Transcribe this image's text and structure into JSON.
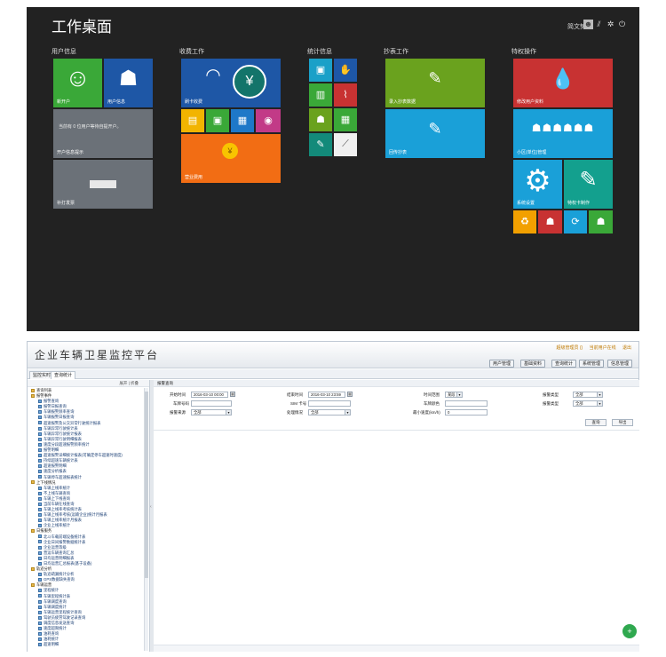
{
  "desktop": {
    "title": "工作桌面",
    "user_name": "简文势",
    "groups": {
      "user_info": "用户信息",
      "billing": "收费工作",
      "stats": "统计信息",
      "reading": "抄表工作",
      "privileged": "特权操作"
    },
    "tiles": {
      "new_user": "新开户",
      "user_info": "用户信息",
      "user_info_wide_text": "当前有 0 位用户等待自提开户。",
      "user_info_wide": "开户信息提示",
      "print": "补打发票",
      "card_charge": "刷卡收费",
      "business_expense": "营业费用",
      "batch_read": "录入抄表数据",
      "read_detail": "回传抄表",
      "modify_user": "修改用户资料",
      "community": "小区(单位)管理",
      "system_settings": "系统设置",
      "special_bill": "特权卡制作"
    }
  },
  "app": {
    "title": "企业车辆卫星监控平台",
    "top_links": [
      "超级管理员 ()",
      "当前用户在线",
      "退出"
    ],
    "menus": [
      "用户管理",
      "基础资料",
      "查询统计",
      "系统管理",
      "信息管理"
    ],
    "tabs": [
      "监控实时",
      "查询统计"
    ],
    "left_panel_head": [
      "展开",
      "折叠"
    ],
    "section_title": "报警查询",
    "tree": [
      {
        "t": "grp",
        "label": "查询列表"
      },
      {
        "t": "grp",
        "label": "报警事件"
      },
      {
        "t": "leaf",
        "label": "报警查询"
      },
      {
        "t": "leaf",
        "label": "报警日报查询"
      },
      {
        "t": "leaf",
        "label": "车辆报警频率查询"
      },
      {
        "t": "leaf",
        "label": "车辆报警日报查询"
      },
      {
        "t": "leaf",
        "label": "超速报警及公交异常行驶统计报表"
      },
      {
        "t": "leaf",
        "label": "车辆异常行驶统计表"
      },
      {
        "t": "leaf",
        "label": "车辆异常行驶统计报表"
      },
      {
        "t": "leaf",
        "label": "车辆异常行驶明细报表"
      },
      {
        "t": "leaf",
        "label": "速度分段超速报警频率统计"
      },
      {
        "t": "leaf",
        "label": "报警明细"
      },
      {
        "t": "leaf",
        "label": "超速报警详细统计报表(可确定停车超速时速度)"
      },
      {
        "t": "leaf",
        "label": "持续超速车辆统计表"
      },
      {
        "t": "leaf",
        "label": "超速报警明细"
      },
      {
        "t": "leaf",
        "label": "速度分析报表"
      },
      {
        "t": "leaf",
        "label": "车辆停车超速报表统计"
      },
      {
        "t": "grp",
        "label": "上下线情况"
      },
      {
        "t": "leaf",
        "label": "车辆上线率统计"
      },
      {
        "t": "leaf",
        "label": "不上线车辆查询"
      },
      {
        "t": "leaf",
        "label": "车辆上下线查询"
      },
      {
        "t": "leaf",
        "label": "当前车辆在线查询"
      },
      {
        "t": "leaf",
        "label": "车辆上线率考核统计表"
      },
      {
        "t": "leaf",
        "label": "车辆上线率考核(运输企业)统计月报表"
      },
      {
        "t": "leaf",
        "label": "车辆上线率统计月报表"
      },
      {
        "t": "leaf",
        "label": "企业上线率统计"
      },
      {
        "t": "grp",
        "label": "日报服务"
      },
      {
        "t": "leaf",
        "label": "北斗车载前端设备统计表"
      },
      {
        "t": "leaf",
        "label": "企业日间报警数据统计表"
      },
      {
        "t": "leaf",
        "label": "企业运营等级"
      },
      {
        "t": "leaf",
        "label": "营运车辆查询汇总"
      },
      {
        "t": "leaf",
        "label": "日均运营明细报表"
      },
      {
        "t": "leaf",
        "label": "日均运营汇总报表(基于设备)"
      },
      {
        "t": "grp",
        "label": "轨迹分析"
      },
      {
        "t": "leaf",
        "label": "轨迹疏漏统计分析"
      },
      {
        "t": "leaf",
        "label": "GPS数据缺失查询"
      },
      {
        "t": "grp",
        "label": "车辆运营"
      },
      {
        "t": "leaf",
        "label": "里程统计"
      },
      {
        "t": "leaf",
        "label": "车辆里程统计表"
      },
      {
        "t": "leaf",
        "label": "车辆调度查询"
      },
      {
        "t": "leaf",
        "label": "车辆调度统计"
      },
      {
        "t": "leaf",
        "label": "车辆运营里程统计查询"
      },
      {
        "t": "leaf",
        "label": "驾驶员疲劳驾驶记录查询"
      },
      {
        "t": "leaf",
        "label": "调度信息发送查询"
      },
      {
        "t": "leaf",
        "label": "速度超限统计"
      },
      {
        "t": "leaf",
        "label": "油耗查询"
      },
      {
        "t": "leaf",
        "label": "油耗统计"
      },
      {
        "t": "leaf",
        "label": "超速明细"
      }
    ],
    "form": {
      "start_time_label": "开始时间",
      "start_time": "2016-03-10 00:00",
      "end_time_label": "结束时间",
      "end_time": "2016-03-10 23:59",
      "range_label": "时间范围",
      "range_value": "某段",
      "alarm_type_label": "报警类型",
      "alarm_type": "全部",
      "plate_label": "车牌号码",
      "plate": "",
      "sim_label": "SIM 卡号",
      "sim": "",
      "color_label": "车牌颜色",
      "color": "",
      "alarm_cat_label": "报警类型",
      "alarm_cat": "全部",
      "alarm_source_label": "报警来源",
      "alarm_source": "全部",
      "handle_label": "处理情况",
      "handle": "全部",
      "min_speed_label": "最小速度(km/h)",
      "min_speed": "0",
      "query_btn": "查询",
      "export_btn": "导出"
    },
    "fab_icon": "plus-icon"
  }
}
